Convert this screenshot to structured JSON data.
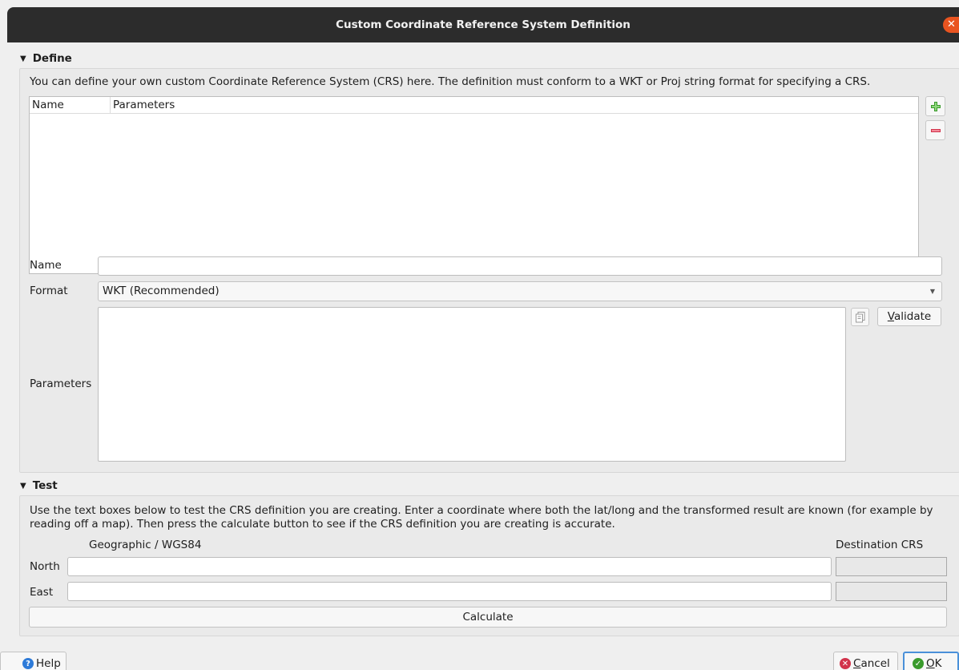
{
  "window": {
    "title": "Custom Coordinate Reference System Definition"
  },
  "define": {
    "header": "Define",
    "description": "You can define your own custom Coordinate Reference System (CRS) here. The definition must conform to a WKT or Proj string format for specifying a CRS.",
    "table": {
      "columns": [
        "Name",
        "Parameters"
      ],
      "rows": []
    },
    "name_label": "Name",
    "name_value": "",
    "format_label": "Format",
    "format_value": "WKT (Recommended)",
    "parameters_label": "Parameters",
    "parameters_value": "",
    "validate_mnemonic": "V",
    "validate_rest": "alidate"
  },
  "test": {
    "header": "Test",
    "description_line1": "Use the text boxes below to test the CRS definition you are creating. Enter a coordinate where both the lat/long and the transformed result are known (for example by",
    "description_line2": "reading off a map). Then press the calculate button to see if the CRS definition you are creating is accurate.",
    "geographic_label": "Geographic / WGS84",
    "destination_label": "Destination CRS",
    "north_label": "North",
    "east_label": "East",
    "north_value": "",
    "east_value": "",
    "calculate_label": "Calculate"
  },
  "footer": {
    "help_label": "Help",
    "cancel_mnemonic": "C",
    "cancel_rest": "ancel",
    "ok_mnemonic": "O",
    "ok_rest": "K"
  },
  "colors": {
    "titlebar": "#2c2c2c",
    "close": "#e95420",
    "add_icon": "#3a9a2c",
    "remove_icon": "#d2334b",
    "help_icon": "#2d7ad8",
    "cancel_icon": "#d2334b",
    "ok_icon": "#3a9a2c",
    "ok_border": "#4a90d9"
  }
}
